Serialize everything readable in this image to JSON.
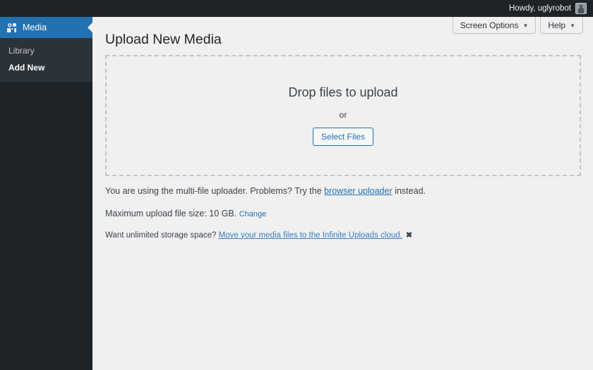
{
  "adminbar": {
    "howdy": "Howdy, uglyrobot",
    "avatar_name": "avatar"
  },
  "sidebar": {
    "menu": {
      "icon": "media-icon",
      "label": "Media"
    },
    "submenu": [
      {
        "label": "Library",
        "current": false
      },
      {
        "label": "Add New",
        "current": true
      }
    ]
  },
  "screen_meta": {
    "screen_options": "Screen Options",
    "help": "Help",
    "caret": "▼"
  },
  "main": {
    "page_title": "Upload New Media",
    "dropzone": {
      "heading": "Drop files to upload",
      "or": "or",
      "select_button": "Select Files"
    },
    "notes": {
      "uploader_prefix": "You are using the multi-file uploader. Problems? Try the ",
      "uploader_link": "browser uploader",
      "uploader_suffix": " instead.",
      "max_size": "Maximum upload file size: 10 GB.",
      "change_link": "Change",
      "iu_prefix": "Want unlimited storage space? ",
      "iu_link": "Move your media files to the Infinite Uploads cloud.",
      "dismiss": "✖"
    }
  },
  "colors": {
    "accent": "#2271b1",
    "sidebar_bg": "#1d2327",
    "submenu_bg": "#2c3338",
    "content_bg": "#f0f0f1",
    "dash_border": "#c3c4c7"
  }
}
